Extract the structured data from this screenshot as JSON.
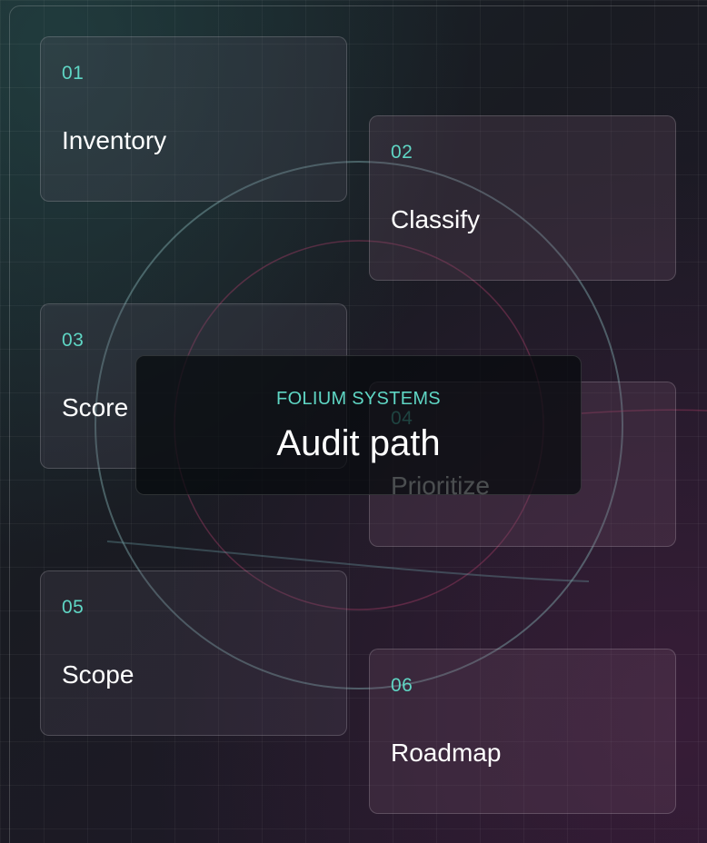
{
  "hub": {
    "brand": "FOLIUM SYSTEMS",
    "title": "Audit path"
  },
  "steps": [
    {
      "number": "01",
      "label": "Inventory"
    },
    {
      "number": "02",
      "label": "Classify"
    },
    {
      "number": "03",
      "label": "Score"
    },
    {
      "number": "04",
      "label": "Prioritize"
    },
    {
      "number": "05",
      "label": "Scope"
    },
    {
      "number": "06",
      "label": "Roadmap"
    }
  ],
  "colors": {
    "accent": "#5fd6c4",
    "text": "#ffffff",
    "ring_outer": "#6f9a9c",
    "ring_inner": "#8a3a5e"
  }
}
